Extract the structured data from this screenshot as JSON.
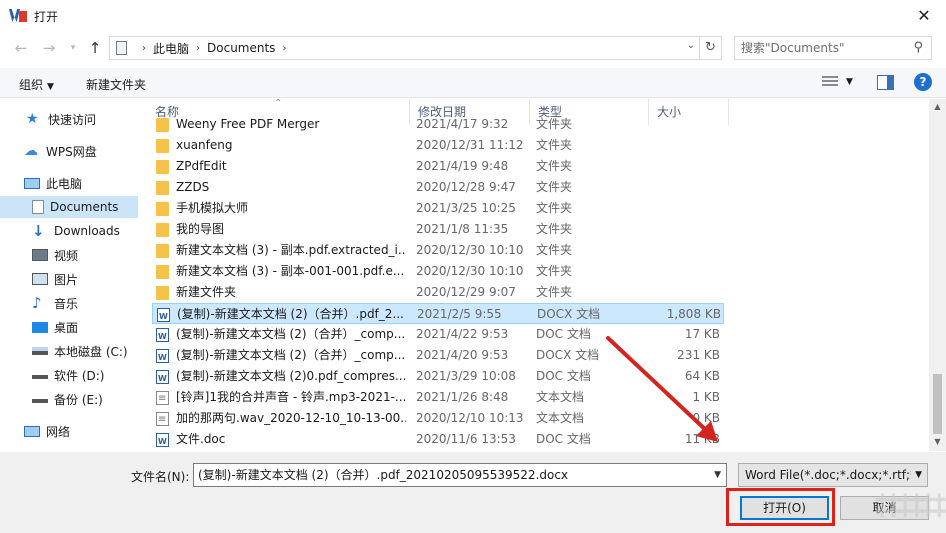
{
  "window": {
    "title": "打开"
  },
  "nav": {
    "breadcrumb": [
      "此电脑",
      "Documents"
    ],
    "search_placeholder": "搜索\"Documents\""
  },
  "toolbar": {
    "organize": "组织",
    "new_folder": "新建文件夹"
  },
  "sidebar": {
    "items": [
      {
        "label": "快速访问",
        "icon": "star-icon"
      },
      {
        "label": "WPS网盘",
        "icon": "cloud-icon"
      },
      {
        "label": "此电脑",
        "icon": "computer-icon"
      },
      {
        "label": "Documents",
        "icon": "document-icon",
        "selected": true
      },
      {
        "label": "Downloads",
        "icon": "download-icon"
      },
      {
        "label": "视频",
        "icon": "video-icon"
      },
      {
        "label": "图片",
        "icon": "picture-icon"
      },
      {
        "label": "音乐",
        "icon": "music-icon"
      },
      {
        "label": "桌面",
        "icon": "desktop-icon"
      },
      {
        "label": "本地磁盘 (C:)",
        "icon": "drive-icon"
      },
      {
        "label": "软件 (D:)",
        "icon": "drive-icon"
      },
      {
        "label": "备份 (E:)",
        "icon": "drive-icon"
      },
      {
        "label": "网络",
        "icon": "network-icon"
      }
    ]
  },
  "columns": {
    "name": "名称",
    "date": "修改日期",
    "type": "类型",
    "size": "大小"
  },
  "files": [
    {
      "name": "Weeny Free PDF Merger",
      "date": "2021/4/17 9:32",
      "type": "文件夹",
      "size": "",
      "icon": "folder-icon"
    },
    {
      "name": "xuanfeng",
      "date": "2020/12/31 11:12",
      "type": "文件夹",
      "size": "",
      "icon": "folder-icon"
    },
    {
      "name": "ZPdfEdit",
      "date": "2021/4/19 9:48",
      "type": "文件夹",
      "size": "",
      "icon": "folder-icon"
    },
    {
      "name": "ZZDS",
      "date": "2020/12/28 9:47",
      "type": "文件夹",
      "size": "",
      "icon": "folder-icon"
    },
    {
      "name": "手机模拟大师",
      "date": "2021/3/25 10:25",
      "type": "文件夹",
      "size": "",
      "icon": "folder-icon"
    },
    {
      "name": "我的导图",
      "date": "2021/1/8 11:35",
      "type": "文件夹",
      "size": "",
      "icon": "folder-icon"
    },
    {
      "name": "新建文本文档 (3) - 副本.pdf.extracted_i...",
      "date": "2020/12/30 10:10",
      "type": "文件夹",
      "size": "",
      "icon": "folder-icon"
    },
    {
      "name": "新建文本文档 (3) - 副本-001-001.pdf.e...",
      "date": "2020/12/30 10:10",
      "type": "文件夹",
      "size": "",
      "icon": "folder-icon"
    },
    {
      "name": "新建文件夹",
      "date": "2020/12/29 9:07",
      "type": "文件夹",
      "size": "",
      "icon": "folder-icon"
    },
    {
      "name": "(复制)-新建文本文档 (2)（合并）.pdf_2...",
      "date": "2021/2/5 9:55",
      "type": "DOCX 文档",
      "size": "1,808 KB",
      "icon": "word-doc-icon",
      "selected": true
    },
    {
      "name": "(复制)-新建文本文档 (2)（合并）_comp...",
      "date": "2021/4/22 9:53",
      "type": "DOC 文档",
      "size": "17 KB",
      "icon": "word-doc-icon"
    },
    {
      "name": "(复制)-新建文本文档 (2)（合并）_comp...",
      "date": "2021/4/20 9:53",
      "type": "DOCX 文档",
      "size": "231 KB",
      "icon": "word-doc-icon"
    },
    {
      "name": "(复制)-新建文本文档 (2)0.pdf_compres...",
      "date": "2021/3/29 10:08",
      "type": "DOC 文档",
      "size": "64 KB",
      "icon": "word-doc-icon"
    },
    {
      "name": "[铃声]1我的合并声音 - 铃声.mp3-2021-...",
      "date": "2021/1/26 8:48",
      "type": "文本文档",
      "size": "1 KB",
      "icon": "text-file-icon"
    },
    {
      "name": "加的那两句.wav_2020-12-10_10-13-00....",
      "date": "2020/12/10 10:13",
      "type": "文本文档",
      "size": "0 KB",
      "icon": "text-file-icon"
    },
    {
      "name": "文件.doc",
      "date": "2020/11/6 13:53",
      "type": "DOC 文档",
      "size": "11 KB",
      "icon": "word-doc-icon"
    }
  ],
  "bottom": {
    "filename_label": "文件名(N):",
    "filename_value": "(复制)-新建文本文档 (2)（合并）.pdf_20210205095539522.docx",
    "filetype_value": "Word File(*.doc;*.docx;*.rtf;*.",
    "open_label": "打开(O)",
    "cancel_label": "取消"
  },
  "annotation_color": "#e0201b"
}
